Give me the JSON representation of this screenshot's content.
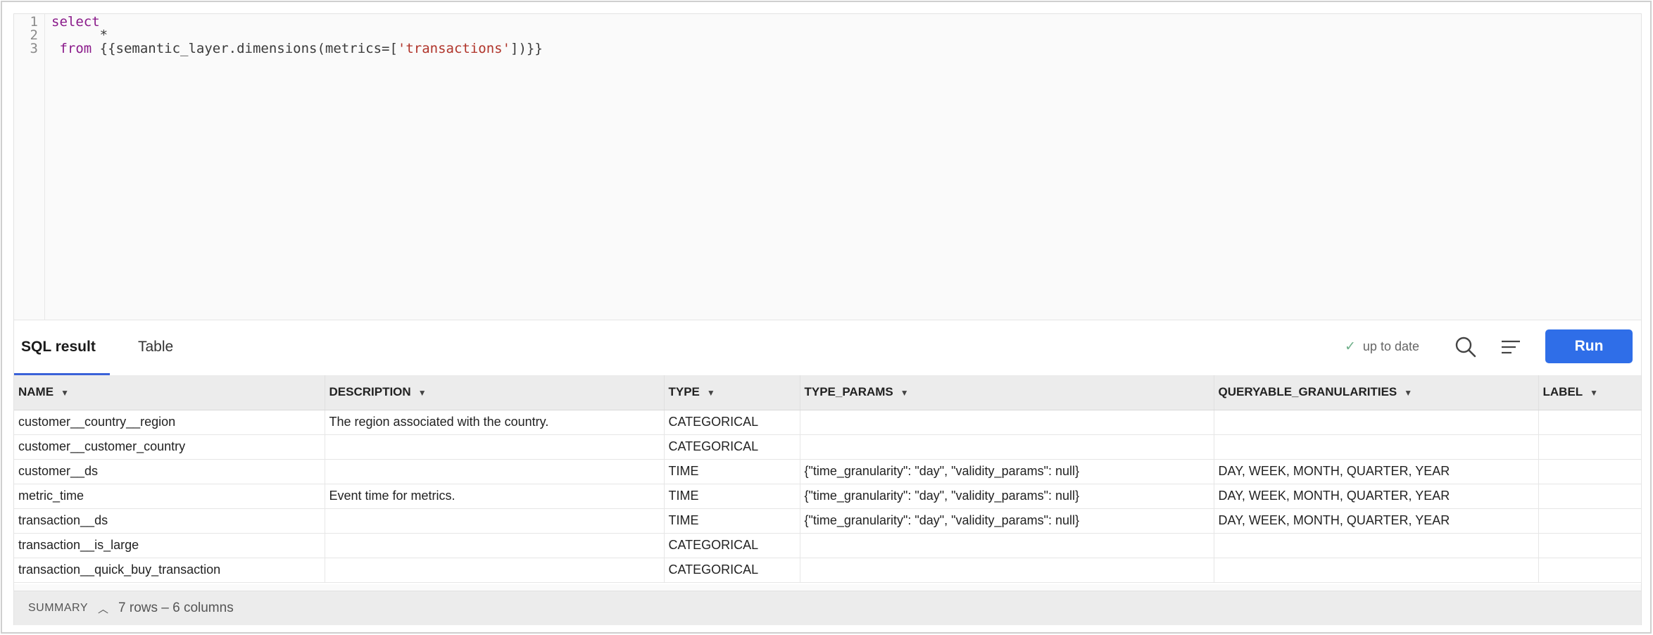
{
  "editor": {
    "line_numbers": [
      "1",
      "2",
      "3"
    ],
    "lines": [
      {
        "kw": "select",
        "pre": "",
        "text": "",
        "str": "",
        "post": ""
      },
      {
        "kw": "",
        "pre": "      *",
        "text": "",
        "str": "",
        "post": ""
      },
      {
        "kw": " from",
        "pre": "",
        "text": " {{semantic_layer.dimensions(metrics=[",
        "str": "'transactions'",
        "post": "])}}"
      }
    ]
  },
  "tabs": {
    "sql_result": "SQL result",
    "table": "Table"
  },
  "toolbar": {
    "status": "up to date",
    "run_label": "Run"
  },
  "table": {
    "columns": [
      "NAME",
      "DESCRIPTION",
      "TYPE",
      "TYPE_PARAMS",
      "QUERYABLE_GRANULARITIES",
      "LABEL"
    ],
    "rows": [
      [
        "customer__country__region",
        "The region associated with the country.",
        "CATEGORICAL",
        "",
        "",
        ""
      ],
      [
        "customer__customer_country",
        "",
        "CATEGORICAL",
        "",
        "",
        ""
      ],
      [
        "customer__ds",
        "",
        "TIME",
        "{\"time_granularity\": \"day\", \"validity_params\": null}",
        "DAY, WEEK, MONTH, QUARTER, YEAR",
        ""
      ],
      [
        "metric_time",
        "Event time for metrics.",
        "TIME",
        "{\"time_granularity\": \"day\", \"validity_params\": null}",
        "DAY, WEEK, MONTH, QUARTER, YEAR",
        ""
      ],
      [
        "transaction__ds",
        "",
        "TIME",
        "{\"time_granularity\": \"day\", \"validity_params\": null}",
        "DAY, WEEK, MONTH, QUARTER, YEAR",
        ""
      ],
      [
        "transaction__is_large",
        "",
        "CATEGORICAL",
        "",
        "",
        ""
      ],
      [
        "transaction__quick_buy_transaction",
        "",
        "CATEGORICAL",
        "",
        "",
        ""
      ]
    ]
  },
  "summary": {
    "label": "SUMMARY",
    "info": "7 rows – 6 columns"
  },
  "icons": {
    "status": "check-icon",
    "search": "search-icon",
    "format": "format-lines-icon",
    "column_sort": "caret-down-icon",
    "summary_toggle": "chevron-up-icon"
  },
  "colors": {
    "accent": "#2f6ee8",
    "keyword": "#8a1a8a",
    "string": "#b0342a"
  }
}
